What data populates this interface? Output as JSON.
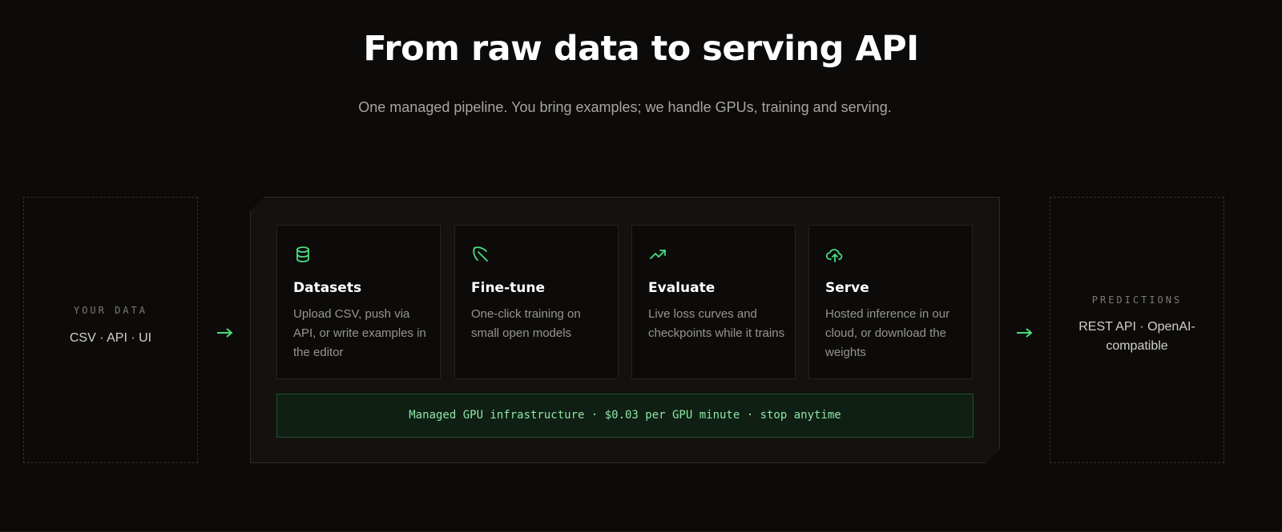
{
  "header": {
    "title": "From raw data to serving API",
    "subtitle": "One managed pipeline. You bring examples; we handle GPUs, training and serving."
  },
  "input_box": {
    "label": "YOUR DATA",
    "value": "CSV · API · UI"
  },
  "output_box": {
    "label": "PREDICTIONS",
    "value": "REST API · OpenAI-compatible"
  },
  "stages": [
    {
      "icon": "database-icon",
      "title": "Datasets",
      "description": "Upload CSV, push via API, or write examples in the editor"
    },
    {
      "icon": "pickaxe-icon",
      "title": "Fine-tune",
      "description": "One-click training on small open models"
    },
    {
      "icon": "trending-up-icon",
      "title": "Evaluate",
      "description": "Live loss curves and checkpoints while it trains"
    },
    {
      "icon": "cloud-upload-icon",
      "title": "Serve",
      "description": "Hosted inference in our cloud, or download the weights"
    }
  ],
  "infrastructure": {
    "text": "Managed GPU infrastructure · $0.03 per GPU minute · stop anytime"
  },
  "colors": {
    "background": "#0c0b0a",
    "accent_green": "#4ade80",
    "infra_text": "#8ee6a4"
  }
}
